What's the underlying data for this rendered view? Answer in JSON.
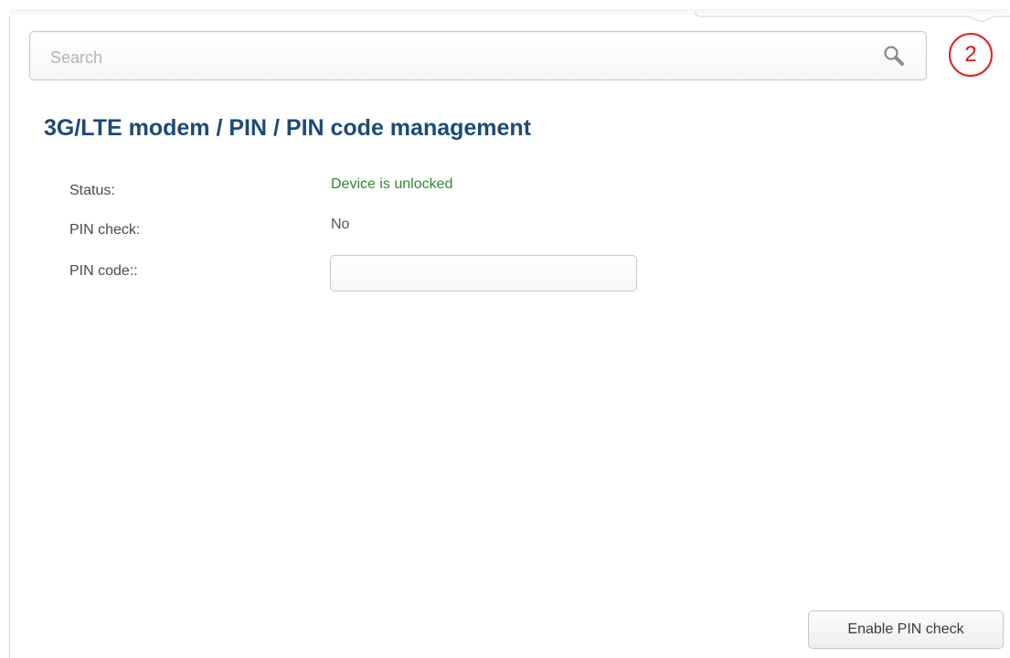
{
  "search": {
    "placeholder": "Search",
    "value": ""
  },
  "notification": {
    "count": "2",
    "color": "#e02020"
  },
  "breadcrumb": {
    "items": [
      "3G/LTE modem",
      "PIN",
      "PIN code management"
    ],
    "separator": " / "
  },
  "form": {
    "status_label": "Status:",
    "status_value": "Device is unlocked",
    "status_color": "#2e8b2e",
    "pin_check_label": "PIN check:",
    "pin_check_value": "No",
    "pin_code_label": "PIN code::",
    "pin_code_value": ""
  },
  "actions": {
    "enable_pin_check_label": "Enable PIN check"
  },
  "colors": {
    "title": "#1b4a7a",
    "accent_red": "#e02020"
  }
}
